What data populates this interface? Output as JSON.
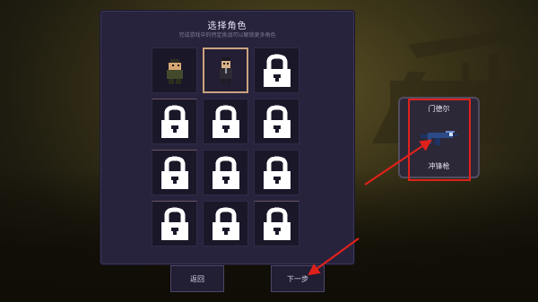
{
  "panel": {
    "title": "选择角色",
    "subtitle": "完成游戏中的特定挑战可以解锁更多角色"
  },
  "slots": [
    {
      "state": "character",
      "icon": "soldier-character-icon"
    },
    {
      "state": "character-selected",
      "icon": "officer-character-icon"
    },
    {
      "state": "locked",
      "icon": "lock-icon"
    },
    {
      "state": "locked",
      "icon": "lock-icon"
    },
    {
      "state": "locked",
      "icon": "lock-icon"
    },
    {
      "state": "locked",
      "icon": "lock-icon"
    },
    {
      "state": "locked",
      "icon": "lock-icon"
    },
    {
      "state": "locked",
      "icon": "lock-icon"
    },
    {
      "state": "locked",
      "icon": "lock-icon"
    },
    {
      "state": "locked",
      "icon": "lock-icon"
    },
    {
      "state": "locked",
      "icon": "lock-icon"
    },
    {
      "state": "locked",
      "icon": "lock-icon"
    }
  ],
  "buttons": {
    "back_label": "返回",
    "next_label": "下一步"
  },
  "weapon": {
    "name": "门德尔",
    "type": "冲锋枪",
    "icon": "smg-gun-icon"
  },
  "annotation": {
    "highlight_color": "#e0211b",
    "arrow_color": "#e0211b"
  }
}
